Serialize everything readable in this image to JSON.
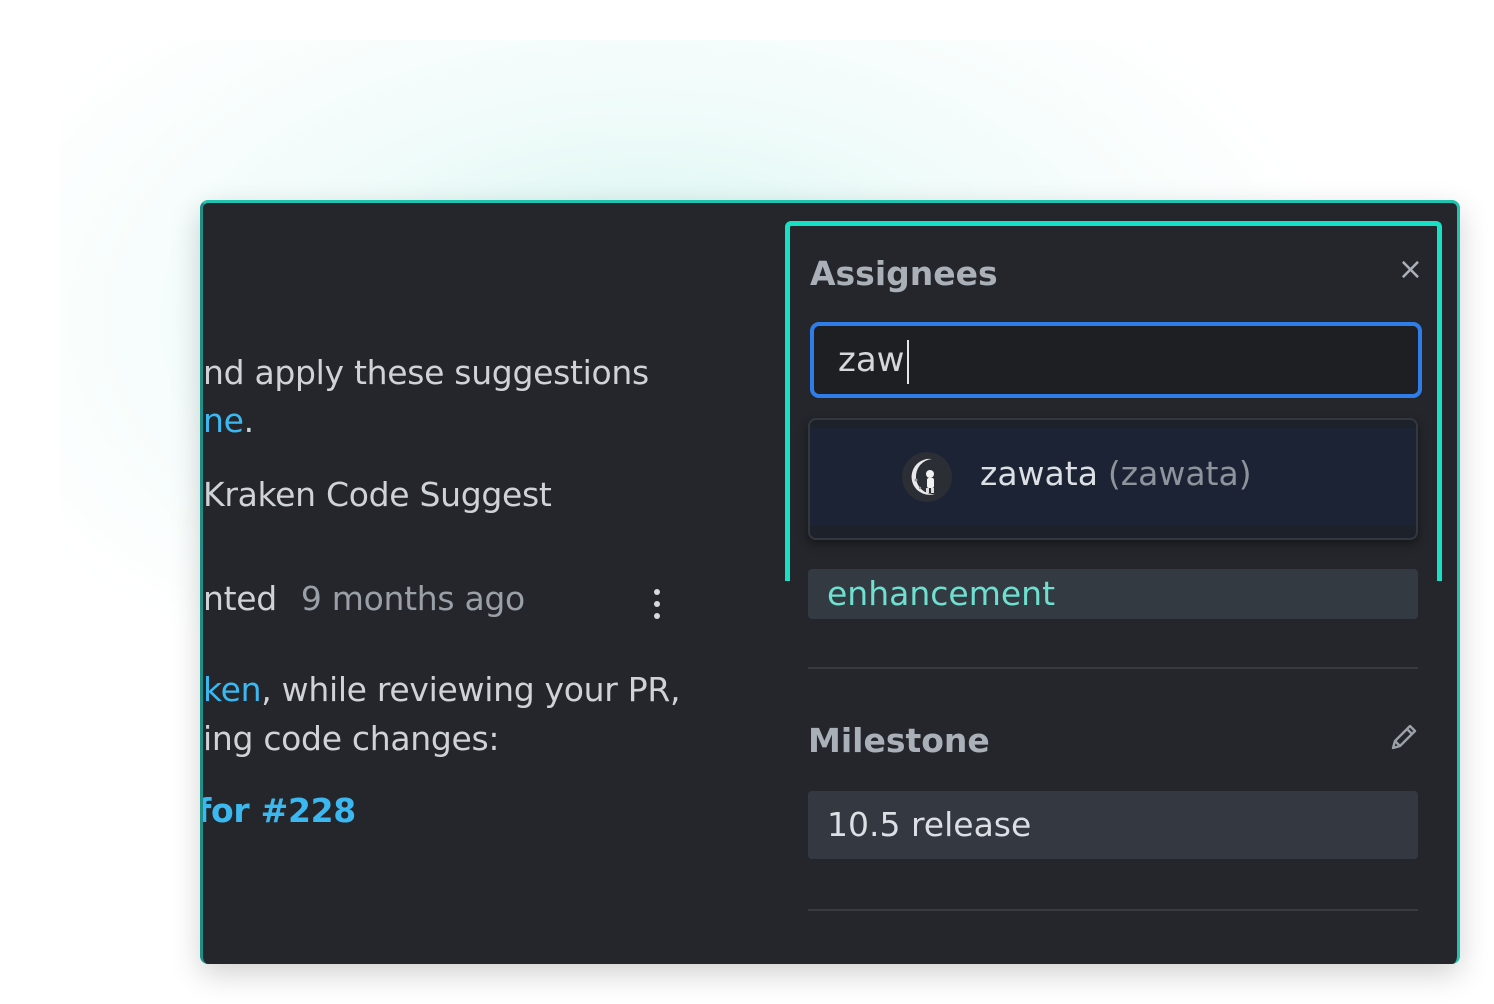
{
  "comment": {
    "line1": "nd apply these suggestions",
    "line2_link": "ne",
    "line2_rest": ".",
    "line3": "Kraken Code Suggest",
    "meta_prefix": "nted",
    "meta_time": "9 months ago",
    "body_link": "ken",
    "body_rest": ", while reviewing your PR,",
    "body_line2": "ing code changes:",
    "ref_link": "for #228"
  },
  "assignees": {
    "title": "Assignees",
    "close_glyph": "×",
    "search_value": "zaw",
    "results": [
      {
        "name": "zawata",
        "login": "(zawata)",
        "avatar_icon": "astronaut-moon-avatar"
      }
    ]
  },
  "labels": {
    "items": [
      "enhancement"
    ]
  },
  "milestone": {
    "title": "Milestone",
    "value": "10.5 release",
    "edit_icon": "pencil-icon"
  },
  "colors": {
    "accent_border": "#17e0c4",
    "focus_border": "#2f7de8",
    "link": "#3bb8ef",
    "label_text": "#6fe0d0",
    "background": "#24262b"
  }
}
